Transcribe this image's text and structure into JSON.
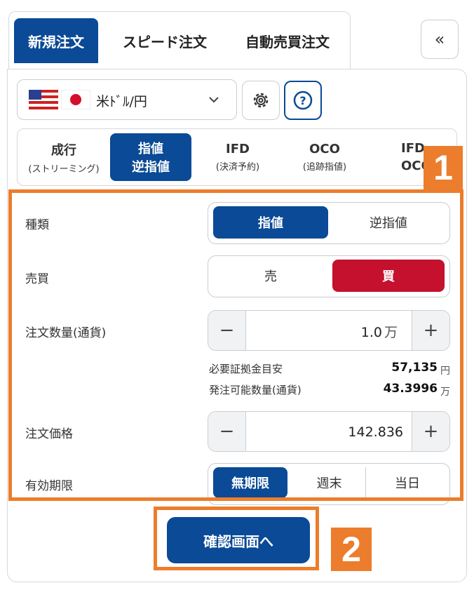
{
  "tabs": [
    {
      "label": "新規注文",
      "active": true
    },
    {
      "label": "スピード注文",
      "active": false
    },
    {
      "label": "自動売買注文",
      "active": false
    }
  ],
  "collapse_icon": "double-chevron-left-icon",
  "collapse_glyph": "«",
  "pair": {
    "label": "米ﾄﾞﾙ/円",
    "flags": [
      "us-flag-icon",
      "jp-flag-icon"
    ]
  },
  "order_types": [
    {
      "line1": "成行",
      "line2": "(ストリーミング)",
      "active": false
    },
    {
      "line1": "指値",
      "line2": "逆指値",
      "active": true
    },
    {
      "line1": "IFD",
      "line2": "(決済予約)",
      "active": false
    },
    {
      "line1": "OCO",
      "line2": "(追跡指値)",
      "active": false
    },
    {
      "line1": "IFD",
      "line2": "OCO",
      "active": false
    }
  ],
  "form": {
    "kind": {
      "label": "種類",
      "options": [
        "指値",
        "逆指値"
      ],
      "selected": "指値"
    },
    "side": {
      "label": "売買",
      "options": [
        "売",
        "買"
      ],
      "selected": "買"
    },
    "quantity": {
      "label": "注文数量(通貨)",
      "value": "1.0",
      "unit": "万",
      "minus": "−",
      "plus": "+"
    },
    "margin": {
      "label": "必要証拠金目安",
      "value": "57,135",
      "unit": "円"
    },
    "available": {
      "label": "発注可能数量(通貨)",
      "value": "43.3996",
      "unit": "万"
    },
    "price": {
      "label": "注文価格",
      "value": "142.836",
      "minus": "−",
      "plus": "+"
    },
    "expiry": {
      "label": "有効期限",
      "options": [
        "無期限",
        "週末",
        "当日"
      ],
      "selected": "無期限"
    }
  },
  "confirm_label": "確認画面へ",
  "annotations": [
    "1",
    "2"
  ],
  "colors": {
    "primary": "#0a4a96",
    "buy": "#c5102e",
    "annotation": "#ec7d2c"
  }
}
